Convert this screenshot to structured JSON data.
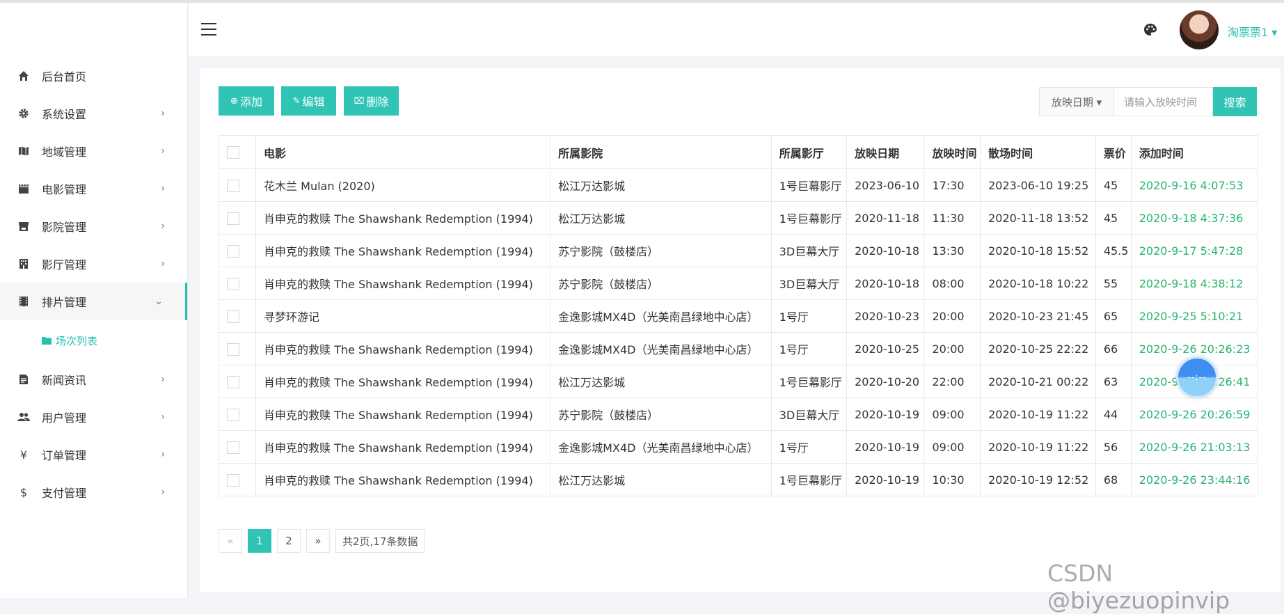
{
  "sidebar": {
    "items": [
      {
        "label": "后台首页",
        "icon": "home-icon",
        "chevron": ""
      },
      {
        "label": "系统设置",
        "icon": "gear-icon",
        "chevron": "›"
      },
      {
        "label": "地域管理",
        "icon": "map-icon",
        "chevron": "›"
      },
      {
        "label": "电影管理",
        "icon": "clapperboard-icon",
        "chevron": "›"
      },
      {
        "label": "影院管理",
        "icon": "store-icon",
        "chevron": "›"
      },
      {
        "label": "影厅管理",
        "icon": "building-icon",
        "chevron": "›"
      },
      {
        "label": "排片管理",
        "icon": "film-icon",
        "chevron": "⌄"
      },
      {
        "label": "新闻资讯",
        "icon": "news-icon",
        "chevron": "›"
      },
      {
        "label": "用户管理",
        "icon": "users-icon",
        "chevron": "›"
      },
      {
        "label": "订单管理",
        "icon": "yen-icon",
        "chevron": "›"
      },
      {
        "label": "支付管理",
        "icon": "dollar-icon",
        "chevron": "›"
      }
    ],
    "sub_item": {
      "label": "场次列表",
      "icon": "folder-icon"
    }
  },
  "header": {
    "username": "淘票票1 ▾",
    "accent": "#26bfb0"
  },
  "toolbar": {
    "add_label": "添加",
    "edit_label": "编辑",
    "delete_label": "删除"
  },
  "search": {
    "select_label": "放映日期 ▾",
    "placeholder": "请输入放映时间",
    "button_label": "搜索"
  },
  "table": {
    "headers": [
      "电影",
      "所属影院",
      "所属影厅",
      "放映日期",
      "放映时间",
      "散场时间",
      "票价",
      "添加时间"
    ],
    "rows": [
      [
        "花木兰 Mulan (2020)",
        "松江万达影城",
        "1号巨幕影厅",
        "2023-06-10",
        "17:30",
        "2023-06-10 19:25",
        "45",
        "2020-9-16 4:07:53"
      ],
      [
        "肖申克的救赎 The Shawshank Redemption (1994)",
        "松江万达影城",
        "1号巨幕影厅",
        "2020-11-18",
        "11:30",
        "2020-11-18 13:52",
        "45",
        "2020-9-18 4:37:36"
      ],
      [
        "肖申克的救赎 The Shawshank Redemption (1994)",
        "苏宁影院（鼓楼店）",
        "3D巨幕大厅",
        "2020-10-18",
        "13:30",
        "2020-10-18 15:52",
        "45.5",
        "2020-9-17 5:47:28"
      ],
      [
        "肖申克的救赎 The Shawshank Redemption (1994)",
        "苏宁影院（鼓楼店）",
        "3D巨幕大厅",
        "2020-10-18",
        "08:00",
        "2020-10-18 10:22",
        "55",
        "2020-9-18 4:38:12"
      ],
      [
        "寻梦环游记",
        "金逸影城MX4D（光美南昌绿地中心店）",
        "1号厅",
        "2020-10-23",
        "20:00",
        "2020-10-23 21:45",
        "65",
        "2020-9-25 5:10:21"
      ],
      [
        "肖申克的救赎 The Shawshank Redemption (1994)",
        "金逸影城MX4D（光美南昌绿地中心店）",
        "1号厅",
        "2020-10-25",
        "20:00",
        "2020-10-25 22:22",
        "66",
        "2020-9-26 20:26:23"
      ],
      [
        "肖申克的救赎 The Shawshank Redemption (1994)",
        "松江万达影城",
        "1号巨幕影厅",
        "2020-10-20",
        "22:00",
        "2020-10-21 00:22",
        "63",
        "2020-9-26 20:26:41"
      ],
      [
        "肖申克的救赎 The Shawshank Redemption (1994)",
        "苏宁影院（鼓楼店）",
        "3D巨幕大厅",
        "2020-10-19",
        "09:00",
        "2020-10-19 11:22",
        "44",
        "2020-9-26 20:26:59"
      ],
      [
        "肖申克的救赎 The Shawshank Redemption (1994)",
        "金逸影城MX4D（光美南昌绿地中心店）",
        "1号厅",
        "2020-10-19",
        "09:00",
        "2020-10-19 11:22",
        "56",
        "2020-9-26 21:03:13"
      ],
      [
        "肖申克的救赎 The Shawshank Redemption (1994)",
        "松江万达影城",
        "1号巨幕影厅",
        "2020-10-19",
        "10:30",
        "2020-10-19 12:52",
        "68",
        "2020-9-26 23:44:16"
      ]
    ]
  },
  "pagination": {
    "prev": "«",
    "pages": [
      "1",
      "2"
    ],
    "next": "»",
    "info": "共2页,17条数据"
  },
  "float_widget": {
    "text": "--:--"
  },
  "watermark": "CSDN @biyezuopinvip"
}
